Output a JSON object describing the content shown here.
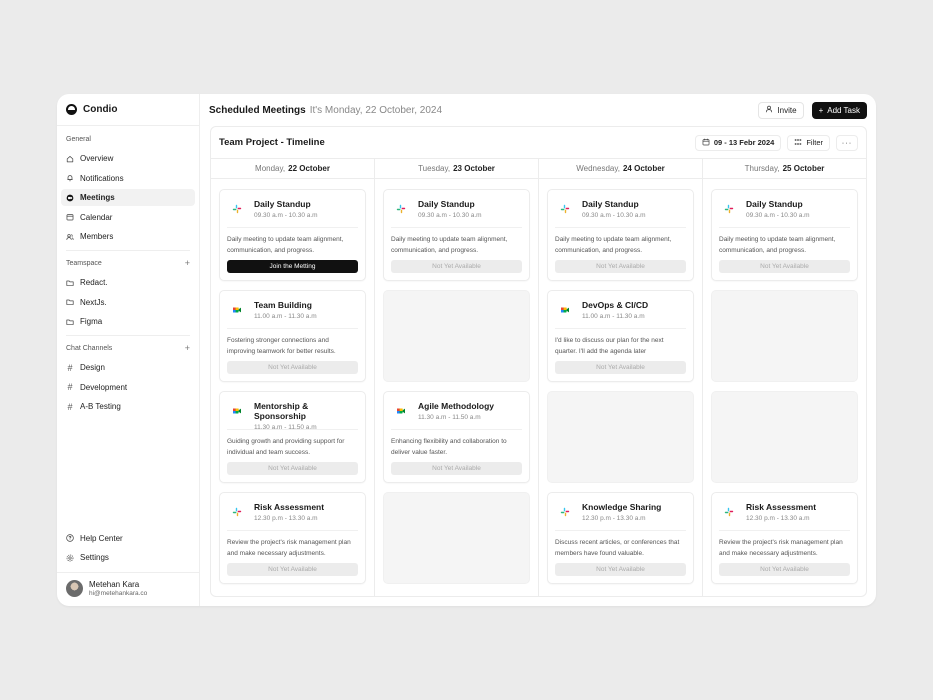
{
  "app": {
    "name": "Condio"
  },
  "sidebar": {
    "general_title": "General",
    "general": [
      {
        "label": "Overview",
        "icon": "home-icon"
      },
      {
        "label": "Notifications",
        "icon": "bell-icon"
      },
      {
        "label": "Meetings",
        "icon": "meeting-icon",
        "active": true
      },
      {
        "label": "Calendar",
        "icon": "calendar-icon"
      },
      {
        "label": "Members",
        "icon": "members-icon"
      }
    ],
    "teamspace_title": "Teamspace",
    "teamspace": [
      "Redact.",
      "NextJs.",
      "Figma"
    ],
    "channels_title": "Chat Channels",
    "channels": [
      "Design",
      "Development",
      "A-B Testing"
    ],
    "help": "Help Center",
    "settings": "Settings",
    "user": {
      "name": "Metehan Kara",
      "email": "hi@metehankara.co"
    }
  },
  "header": {
    "title": "Scheduled Meetings",
    "date": "It's Monday, 22 October, 2024",
    "invite_label": "Invite",
    "add_label": "Add Task"
  },
  "panel": {
    "title": "Team Project - Timeline",
    "date_range": "09 - 13 Febr 2024",
    "filter_label": "Filter",
    "more": "···"
  },
  "columns": [
    {
      "day": "Monday,",
      "date": "22 October",
      "cards": [
        {
          "title": "Daily Standup",
          "time": "09.30 a.m - 10.30 a.m",
          "desc": "Daily meeting to update team alignment, communication, and progress.",
          "button": "Join the Metting",
          "primary": true,
          "icon": "slack"
        },
        {
          "title": "Team Building",
          "time": "11.00 a.m - 11.30 a.m",
          "desc": "Fostering stronger connections and improving teamwork for better results.",
          "button": "Not Yet Available",
          "icon": "meet"
        },
        {
          "title": "Mentorship & Sponsorship",
          "time": "11.30 a.m - 11.50 a.m",
          "desc": "Guiding growth and providing support for individual and team success.",
          "button": "Not Yet Available",
          "icon": "meet"
        },
        {
          "title": "Risk Assessment",
          "time": "12.30 p.m - 13.30 a.m",
          "desc": "Review the project's risk management plan and make necessary adjustments.",
          "button": "Not Yet Available",
          "icon": "slack"
        }
      ]
    },
    {
      "day": "Tuesday,",
      "date": "23 October",
      "cards": [
        {
          "title": "Daily Standup",
          "time": "09.30 a.m - 10.30 a.m",
          "desc": "Daily meeting to update team alignment, communication, and progress.",
          "button": "Not Yet Available",
          "icon": "slack"
        },
        {
          "empty": true
        },
        {
          "title": "Agile Methodology",
          "time": "11.30 a.m - 11.50 a.m",
          "desc": "Enhancing flexibility and collaboration to deliver value faster.",
          "button": "Not Yet Available",
          "icon": "meet"
        },
        {
          "empty": true
        }
      ]
    },
    {
      "day": "Wednesday,",
      "date": "24 October",
      "cards": [
        {
          "title": "Daily Standup",
          "time": "09.30 a.m - 10.30 a.m",
          "desc": "Daily meeting to update team alignment, communication, and progress.",
          "button": "Not Yet Available",
          "icon": "slack"
        },
        {
          "title": "DevOps & CI/CD",
          "time": "11.00 a.m - 11.30 a.m",
          "desc": "I'd like to discuss our plan for the next quarter. I'll add the agenda later",
          "button": "Not Yet Available",
          "icon": "meet"
        },
        {
          "empty": true
        },
        {
          "title": "Knowledge Sharing",
          "time": "12.30 p.m - 13.30 a.m",
          "desc": "Discuss recent articles, or conferences that members have found valuable.",
          "button": "Not Yet Available",
          "icon": "slack"
        }
      ]
    },
    {
      "day": "Thursday,",
      "date": "25 October",
      "cards": [
        {
          "title": "Daily Standup",
          "time": "09.30 a.m - 10.30 a.m",
          "desc": "Daily meeting to update team alignment, communication, and progress.",
          "button": "Not Yet Available",
          "icon": "slack"
        },
        {
          "empty": true
        },
        {
          "empty": true
        },
        {
          "title": "Risk Assessment",
          "time": "12.30 p.m - 13.30 a.m",
          "desc": "Review the project's risk management plan and make necessary adjustments.",
          "button": "Not Yet Available",
          "icon": "slack"
        }
      ]
    }
  ]
}
